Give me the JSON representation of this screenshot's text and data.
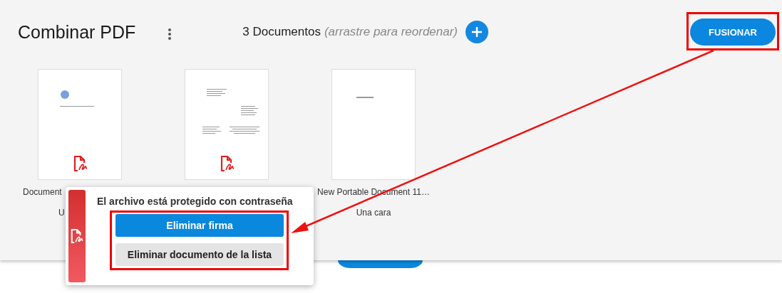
{
  "header": {
    "title": "Combinar PDF",
    "count": "3 Documentos",
    "hint": "(arrastre para reordenar)",
    "merge_button": "FUSIONAR"
  },
  "documents": [
    {
      "name": "Document",
      "subtitle": "U",
      "signed": true
    },
    {
      "signed": true
    },
    {
      "name": "New Portable Document 11…",
      "subtitle": "Una cara",
      "signed": false
    }
  ],
  "popover": {
    "message": "El archivo está protegido con contraseña",
    "buttons": [
      {
        "label": "Eliminar firma",
        "kind": "primary"
      },
      {
        "label": "Eliminar documento de la lista",
        "kind": "secondary"
      }
    ]
  }
}
